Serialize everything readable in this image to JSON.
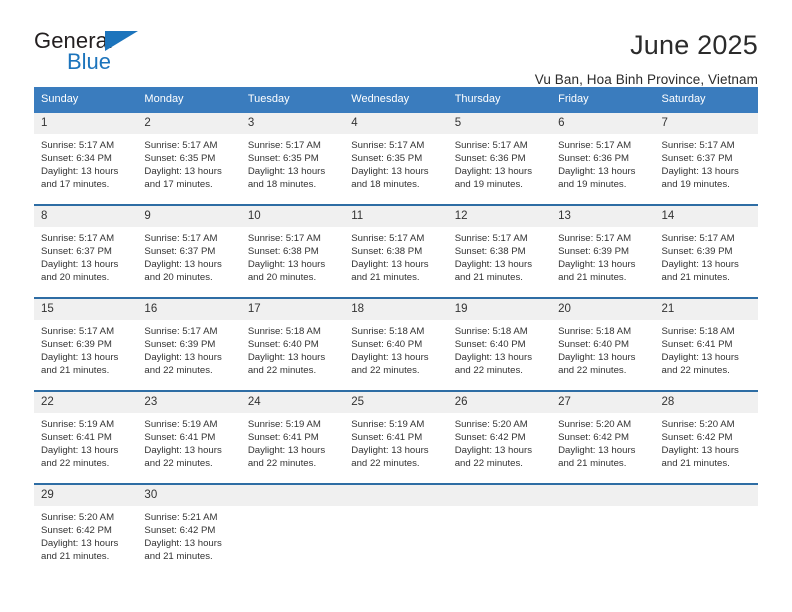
{
  "brand": {
    "name_part1": "General",
    "name_part2": "Blue",
    "triangle_icon": "triangle-icon",
    "accent_color": "#1c74bc"
  },
  "header": {
    "title": "June 2025",
    "subtitle": "Vu Ban, Hoa Binh Province, Vietnam"
  },
  "calendar": {
    "header_bg": "#3a7cbe",
    "row_border": "#2e6da4",
    "daynum_bg": "#f0f0f0",
    "weekdays": [
      "Sunday",
      "Monday",
      "Tuesday",
      "Wednesday",
      "Thursday",
      "Friday",
      "Saturday"
    ],
    "weeks": [
      [
        {
          "day": "1",
          "sunrise": "Sunrise: 5:17 AM",
          "sunset": "Sunset: 6:34 PM",
          "daylight1": "Daylight: 13 hours",
          "daylight2": "and 17 minutes."
        },
        {
          "day": "2",
          "sunrise": "Sunrise: 5:17 AM",
          "sunset": "Sunset: 6:35 PM",
          "daylight1": "Daylight: 13 hours",
          "daylight2": "and 17 minutes."
        },
        {
          "day": "3",
          "sunrise": "Sunrise: 5:17 AM",
          "sunset": "Sunset: 6:35 PM",
          "daylight1": "Daylight: 13 hours",
          "daylight2": "and 18 minutes."
        },
        {
          "day": "4",
          "sunrise": "Sunrise: 5:17 AM",
          "sunset": "Sunset: 6:35 PM",
          "daylight1": "Daylight: 13 hours",
          "daylight2": "and 18 minutes."
        },
        {
          "day": "5",
          "sunrise": "Sunrise: 5:17 AM",
          "sunset": "Sunset: 6:36 PM",
          "daylight1": "Daylight: 13 hours",
          "daylight2": "and 19 minutes."
        },
        {
          "day": "6",
          "sunrise": "Sunrise: 5:17 AM",
          "sunset": "Sunset: 6:36 PM",
          "daylight1": "Daylight: 13 hours",
          "daylight2": "and 19 minutes."
        },
        {
          "day": "7",
          "sunrise": "Sunrise: 5:17 AM",
          "sunset": "Sunset: 6:37 PM",
          "daylight1": "Daylight: 13 hours",
          "daylight2": "and 19 minutes."
        }
      ],
      [
        {
          "day": "8",
          "sunrise": "Sunrise: 5:17 AM",
          "sunset": "Sunset: 6:37 PM",
          "daylight1": "Daylight: 13 hours",
          "daylight2": "and 20 minutes."
        },
        {
          "day": "9",
          "sunrise": "Sunrise: 5:17 AM",
          "sunset": "Sunset: 6:37 PM",
          "daylight1": "Daylight: 13 hours",
          "daylight2": "and 20 minutes."
        },
        {
          "day": "10",
          "sunrise": "Sunrise: 5:17 AM",
          "sunset": "Sunset: 6:38 PM",
          "daylight1": "Daylight: 13 hours",
          "daylight2": "and 20 minutes."
        },
        {
          "day": "11",
          "sunrise": "Sunrise: 5:17 AM",
          "sunset": "Sunset: 6:38 PM",
          "daylight1": "Daylight: 13 hours",
          "daylight2": "and 21 minutes."
        },
        {
          "day": "12",
          "sunrise": "Sunrise: 5:17 AM",
          "sunset": "Sunset: 6:38 PM",
          "daylight1": "Daylight: 13 hours",
          "daylight2": "and 21 minutes."
        },
        {
          "day": "13",
          "sunrise": "Sunrise: 5:17 AM",
          "sunset": "Sunset: 6:39 PM",
          "daylight1": "Daylight: 13 hours",
          "daylight2": "and 21 minutes."
        },
        {
          "day": "14",
          "sunrise": "Sunrise: 5:17 AM",
          "sunset": "Sunset: 6:39 PM",
          "daylight1": "Daylight: 13 hours",
          "daylight2": "and 21 minutes."
        }
      ],
      [
        {
          "day": "15",
          "sunrise": "Sunrise: 5:17 AM",
          "sunset": "Sunset: 6:39 PM",
          "daylight1": "Daylight: 13 hours",
          "daylight2": "and 21 minutes."
        },
        {
          "day": "16",
          "sunrise": "Sunrise: 5:17 AM",
          "sunset": "Sunset: 6:39 PM",
          "daylight1": "Daylight: 13 hours",
          "daylight2": "and 22 minutes."
        },
        {
          "day": "17",
          "sunrise": "Sunrise: 5:18 AM",
          "sunset": "Sunset: 6:40 PM",
          "daylight1": "Daylight: 13 hours",
          "daylight2": "and 22 minutes."
        },
        {
          "day": "18",
          "sunrise": "Sunrise: 5:18 AM",
          "sunset": "Sunset: 6:40 PM",
          "daylight1": "Daylight: 13 hours",
          "daylight2": "and 22 minutes."
        },
        {
          "day": "19",
          "sunrise": "Sunrise: 5:18 AM",
          "sunset": "Sunset: 6:40 PM",
          "daylight1": "Daylight: 13 hours",
          "daylight2": "and 22 minutes."
        },
        {
          "day": "20",
          "sunrise": "Sunrise: 5:18 AM",
          "sunset": "Sunset: 6:40 PM",
          "daylight1": "Daylight: 13 hours",
          "daylight2": "and 22 minutes."
        },
        {
          "day": "21",
          "sunrise": "Sunrise: 5:18 AM",
          "sunset": "Sunset: 6:41 PM",
          "daylight1": "Daylight: 13 hours",
          "daylight2": "and 22 minutes."
        }
      ],
      [
        {
          "day": "22",
          "sunrise": "Sunrise: 5:19 AM",
          "sunset": "Sunset: 6:41 PM",
          "daylight1": "Daylight: 13 hours",
          "daylight2": "and 22 minutes."
        },
        {
          "day": "23",
          "sunrise": "Sunrise: 5:19 AM",
          "sunset": "Sunset: 6:41 PM",
          "daylight1": "Daylight: 13 hours",
          "daylight2": "and 22 minutes."
        },
        {
          "day": "24",
          "sunrise": "Sunrise: 5:19 AM",
          "sunset": "Sunset: 6:41 PM",
          "daylight1": "Daylight: 13 hours",
          "daylight2": "and 22 minutes."
        },
        {
          "day": "25",
          "sunrise": "Sunrise: 5:19 AM",
          "sunset": "Sunset: 6:41 PM",
          "daylight1": "Daylight: 13 hours",
          "daylight2": "and 22 minutes."
        },
        {
          "day": "26",
          "sunrise": "Sunrise: 5:20 AM",
          "sunset": "Sunset: 6:42 PM",
          "daylight1": "Daylight: 13 hours",
          "daylight2": "and 22 minutes."
        },
        {
          "day": "27",
          "sunrise": "Sunrise: 5:20 AM",
          "sunset": "Sunset: 6:42 PM",
          "daylight1": "Daylight: 13 hours",
          "daylight2": "and 21 minutes."
        },
        {
          "day": "28",
          "sunrise": "Sunrise: 5:20 AM",
          "sunset": "Sunset: 6:42 PM",
          "daylight1": "Daylight: 13 hours",
          "daylight2": "and 21 minutes."
        }
      ],
      [
        {
          "day": "29",
          "sunrise": "Sunrise: 5:20 AM",
          "sunset": "Sunset: 6:42 PM",
          "daylight1": "Daylight: 13 hours",
          "daylight2": "and 21 minutes."
        },
        {
          "day": "30",
          "sunrise": "Sunrise: 5:21 AM",
          "sunset": "Sunset: 6:42 PM",
          "daylight1": "Daylight: 13 hours",
          "daylight2": "and 21 minutes."
        },
        {
          "day": "",
          "sunrise": "",
          "sunset": "",
          "daylight1": "",
          "daylight2": ""
        },
        {
          "day": "",
          "sunrise": "",
          "sunset": "",
          "daylight1": "",
          "daylight2": ""
        },
        {
          "day": "",
          "sunrise": "",
          "sunset": "",
          "daylight1": "",
          "daylight2": ""
        },
        {
          "day": "",
          "sunrise": "",
          "sunset": "",
          "daylight1": "",
          "daylight2": ""
        },
        {
          "day": "",
          "sunrise": "",
          "sunset": "",
          "daylight1": "",
          "daylight2": ""
        }
      ]
    ]
  }
}
